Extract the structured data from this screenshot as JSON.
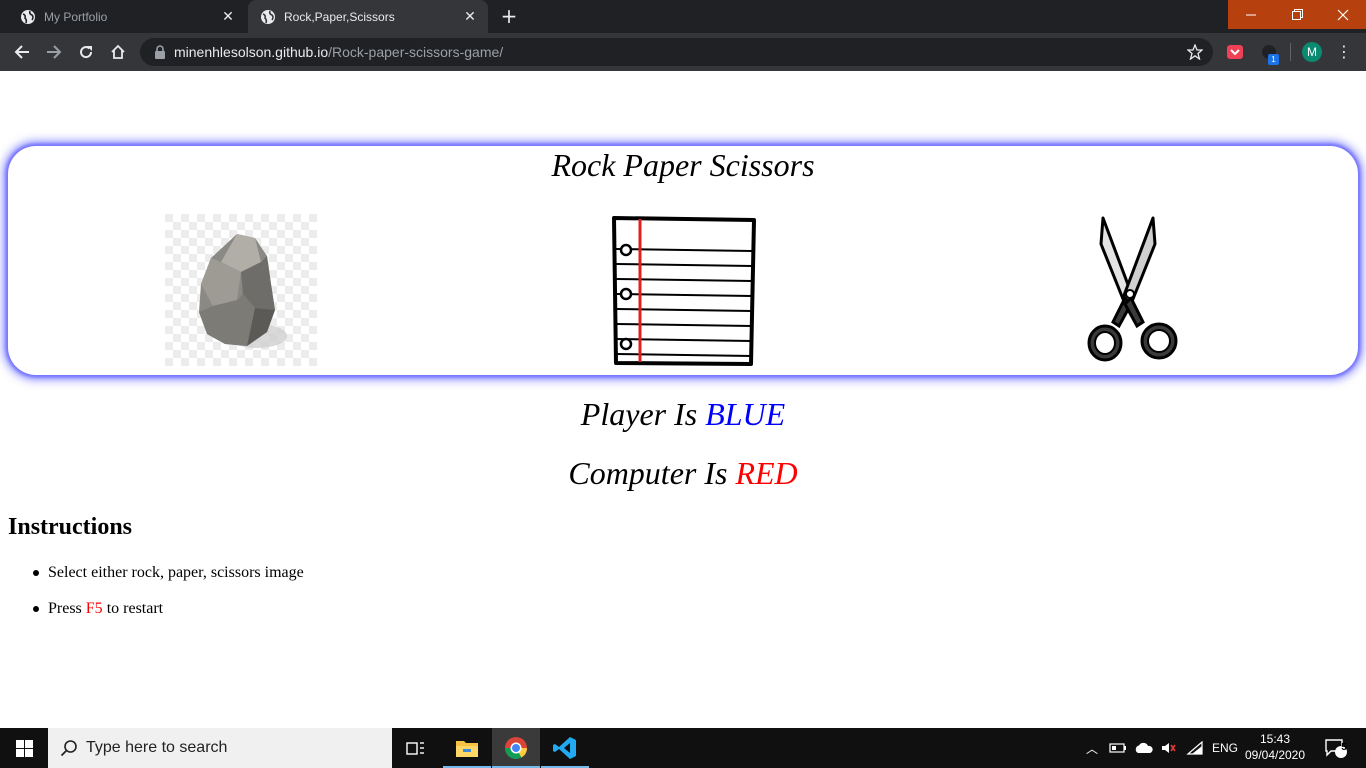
{
  "browser": {
    "tabs": [
      {
        "title": "My Portfolio",
        "active": false
      },
      {
        "title": "Rock,Paper,Scissors",
        "active": true
      }
    ],
    "url_host": "minenhlesolson.github.io",
    "url_path": "/Rock-paper-scissors-game/",
    "profile_initial": "M",
    "extension_badge": "1",
    "colors": {
      "tabbar": "#202124",
      "toolbar": "#35363a",
      "window_controls": "#b7410e",
      "avatar": "#0b8a72"
    }
  },
  "page": {
    "title": "Rock Paper Scissors",
    "choices": [
      {
        "name": "rock",
        "icon": "rock-icon"
      },
      {
        "name": "paper",
        "icon": "notebook-paper-icon"
      },
      {
        "name": "scissors",
        "icon": "scissors-icon"
      }
    ],
    "player_prefix": "Player Is",
    "player_color_name": "BLUE",
    "computer_prefix": "Computer Is",
    "computer_color_name": "RED",
    "instructions_heading": "Instructions",
    "instruction_1": "Select either rock, paper, scissors image",
    "instruction_2_before": "Press",
    "instruction_2_key": "F5",
    "instruction_2_after": "to restart",
    "colors": {
      "player": "#0000ff",
      "computer": "#ff0000",
      "card_glow": "#7b7bff"
    }
  },
  "taskbar": {
    "search_placeholder": "Type here to search",
    "language": "ENG",
    "time": "15:43",
    "date": "09/04/2020",
    "notification_count": "5",
    "apps": [
      "task-view-icon",
      "file-explorer-icon",
      "chrome-icon",
      "vscode-icon"
    ]
  }
}
